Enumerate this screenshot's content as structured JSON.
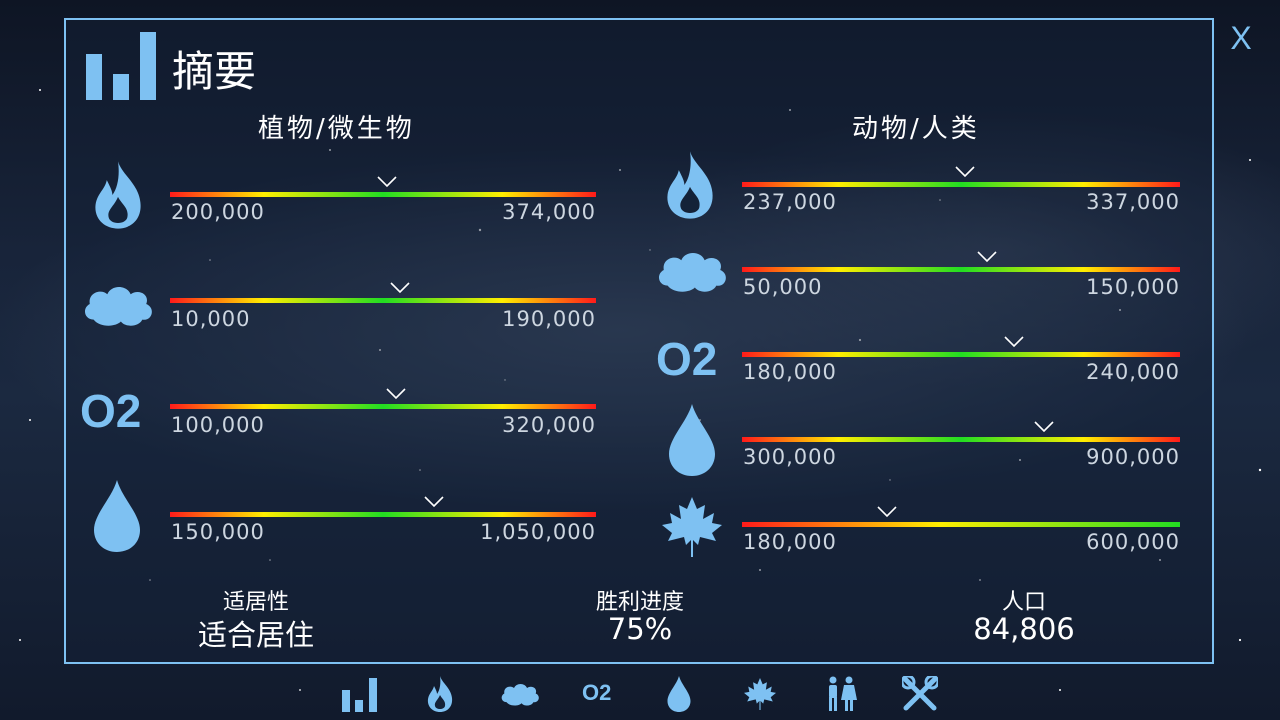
{
  "close_label": "X",
  "title": "摘要",
  "left_column": {
    "title": "植物/微生物",
    "rows": [
      {
        "icon": "flame-icon",
        "min": "200,000",
        "max": "374,000",
        "level": 0.51,
        "gradient": "red-center"
      },
      {
        "icon": "cloud-icon",
        "min": "10,000",
        "max": "190,000",
        "level": 0.54,
        "gradient": "red-center"
      },
      {
        "icon": "o2-icon",
        "label": "O2",
        "min": "100,000",
        "max": "320,000",
        "level": 0.53,
        "gradient": "red-center"
      },
      {
        "icon": "water-drop-icon",
        "min": "150,000",
        "max": "1,050,000",
        "level": 0.62,
        "gradient": "red-center"
      }
    ]
  },
  "right_column": {
    "title": "动物/人类",
    "rows": [
      {
        "icon": "flame-icon",
        "min": "237,000",
        "max": "337,000",
        "level": 0.51,
        "gradient": "red-center"
      },
      {
        "icon": "cloud-icon",
        "min": "50,000",
        "max": "150,000",
        "level": 0.56,
        "gradient": "red-center"
      },
      {
        "icon": "o2-icon",
        "label": "O2",
        "min": "180,000",
        "max": "240,000",
        "level": 0.62,
        "gradient": "red-center"
      },
      {
        "icon": "water-drop-icon",
        "min": "300,000",
        "max": "900,000",
        "level": 0.69,
        "gradient": "red-center"
      },
      {
        "icon": "maple-leaf-icon",
        "min": "180,000",
        "max": "600,000",
        "level": 0.33,
        "gradient": "red-to-green"
      }
    ]
  },
  "stats": {
    "habitability_label": "适居性",
    "habitability_value": "适合居住",
    "victory_label": "胜利进度",
    "victory_value": "75%",
    "population_label": "人口",
    "population_value": "84,806"
  },
  "navbar": {
    "items": [
      "summary-icon",
      "flame-icon",
      "cloud-icon",
      "o2-icon",
      "water-drop-icon",
      "maple-leaf-icon",
      "people-icon",
      "tools-icon"
    ],
    "o2_label": "O2"
  },
  "colors": {
    "accent": "#7ec1f2",
    "bar_red": "#ff1a1a",
    "bar_yellow": "#ffee00",
    "bar_green": "#22dd22"
  }
}
